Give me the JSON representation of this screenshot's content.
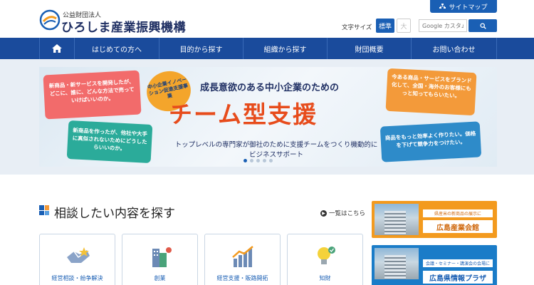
{
  "header": {
    "org_type": "公益財団法人",
    "org_name": "ひろしま産業振興機構",
    "sitemap_label": "サイトマップ",
    "font_size_label": "文字サイズ",
    "font_std": "標準",
    "font_large": "大",
    "search_placeholder": "Google カスタム"
  },
  "nav": {
    "items": [
      {
        "label": "はじめての方へ"
      },
      {
        "label": "目的から探す"
      },
      {
        "label": "組織から探す"
      },
      {
        "label": "財団概要"
      },
      {
        "label": "お問い合わせ"
      }
    ]
  },
  "hero": {
    "bubble1": "新商品・新サービスを開発したが、どこに、誰に、どんな方法で売っていけばいいのか。",
    "bubble2": "新商品を作ったが、他社や大手に真似されないためにどうしたらいいのか。",
    "bubble3": "今ある商品・サービスをブランド化して、全国・海外のお客様にもっと知ってもらいたい。",
    "bubble4": "商品をもっと効率よく作りたい。価格を下げて競争力をつけたい。",
    "badge": "中小企業イノベーション促進支援事業",
    "heading": "成長意欲のある中小企業のための",
    "main": "チーム型支援",
    "sub": "トップレベルの専門家が御社のために支援チームをつくり機動的にビジネスサポート"
  },
  "section": {
    "title": "相談したい内容を探す",
    "list_link": "一覧はこちら",
    "cards": [
      {
        "label": "経営相談・紛争解決"
      },
      {
        "label": "創業"
      },
      {
        "label": "経営支援・販路開拓"
      },
      {
        "label": "知財"
      }
    ]
  },
  "side": {
    "banner1_small": "県産米の新商品の展示に",
    "banner1_main": "広島産業会館",
    "banner2_small": "会議・セミナー・講演会の会場に",
    "banner2_main": "広島県情報プラザ"
  },
  "colors": {
    "brand_blue": "#1a5fb4",
    "nav_blue": "#1a4b9c",
    "accent_orange": "#f39a1e",
    "hero_red": "#e74c1c"
  }
}
